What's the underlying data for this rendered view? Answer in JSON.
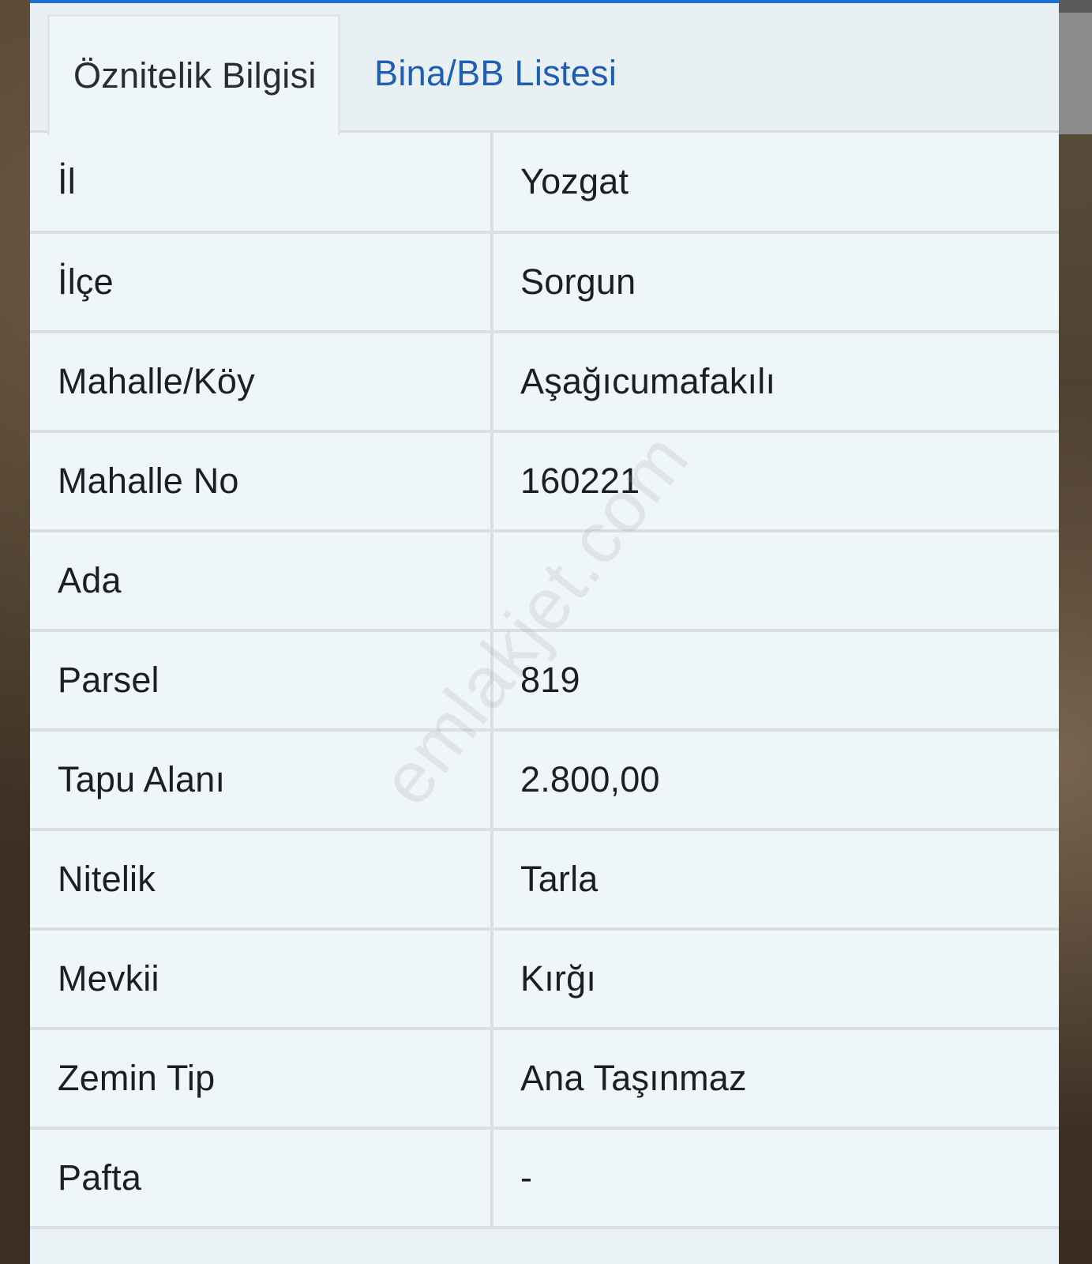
{
  "tabs": [
    {
      "label": "Öznitelik Bilgisi",
      "active": true
    },
    {
      "label": "Bina/BB Listesi",
      "active": false
    }
  ],
  "rows": [
    {
      "label": "İl",
      "value": "Yozgat"
    },
    {
      "label": "İlçe",
      "value": "Sorgun"
    },
    {
      "label": "Mahalle/Köy",
      "value": "Aşağıcumafakılı"
    },
    {
      "label": "Mahalle No",
      "value": "160221"
    },
    {
      "label": "Ada",
      "value": ""
    },
    {
      "label": "Parsel",
      "value": "819"
    },
    {
      "label": "Tapu Alanı",
      "value": "2.800,00"
    },
    {
      "label": "Nitelik",
      "value": "Tarla"
    },
    {
      "label": "Mevkii",
      "value": "Kırğı"
    },
    {
      "label": "Zemin Tip",
      "value": "Ana Taşınmaz"
    },
    {
      "label": "Pafta",
      "value": "-"
    }
  ],
  "watermark": "emlakjet.com",
  "colors": {
    "accent": "#1f6fd1",
    "link": "#1f5fb0",
    "panel_bg": "#eef6fa",
    "border": "#d9dfe2"
  }
}
